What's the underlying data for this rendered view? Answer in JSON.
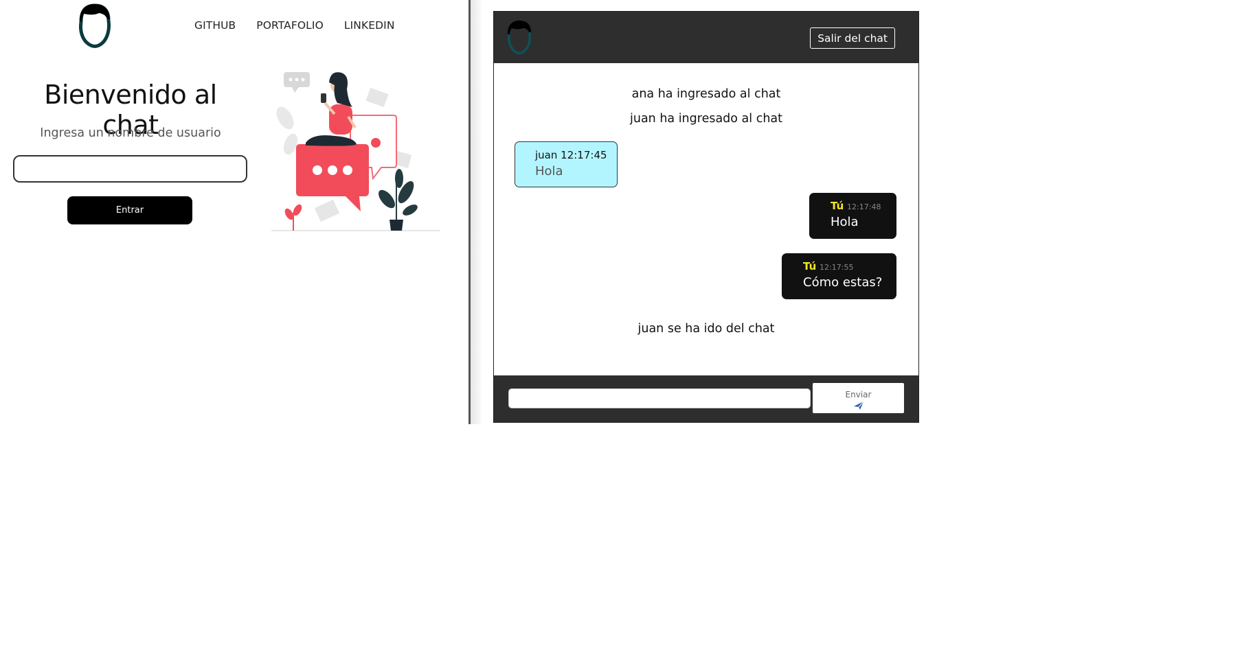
{
  "nav": {
    "items": [
      "GITHUB",
      "PORTAFOLIO",
      "LINKEDIN"
    ]
  },
  "login": {
    "title": "Bienvenido al chat",
    "subtitle": "Ingresa un nombre de usuario",
    "username_value": "",
    "enter_label": "Entrar"
  },
  "chat": {
    "exit_label": "Salir del chat",
    "messages": [
      {
        "kind": "system",
        "text": "ana ha ingresado al chat"
      },
      {
        "kind": "system",
        "text": "juan ha ingresado al chat"
      },
      {
        "kind": "other",
        "author": "juan",
        "time": "12:17:45",
        "text": "Hola"
      },
      {
        "kind": "mine",
        "author": "Tú",
        "time": "12:17:48",
        "text": "Hola"
      },
      {
        "kind": "mine",
        "author": "Tú",
        "time": "12:17:55",
        "text": "Cómo estas?"
      },
      {
        "kind": "system",
        "text": "juan se ha ido del chat"
      }
    ],
    "input_value": "",
    "send_label": "Enviar"
  },
  "colors": {
    "header_bg": "#2e2e2e",
    "other_bubble": "#b2f5ff",
    "mine_bubble": "#111111",
    "mine_author": "#f5e62a",
    "logo_outline": "#0b3b3d"
  },
  "icons": [
    "face-logo-icon",
    "send-arrow-icon"
  ]
}
